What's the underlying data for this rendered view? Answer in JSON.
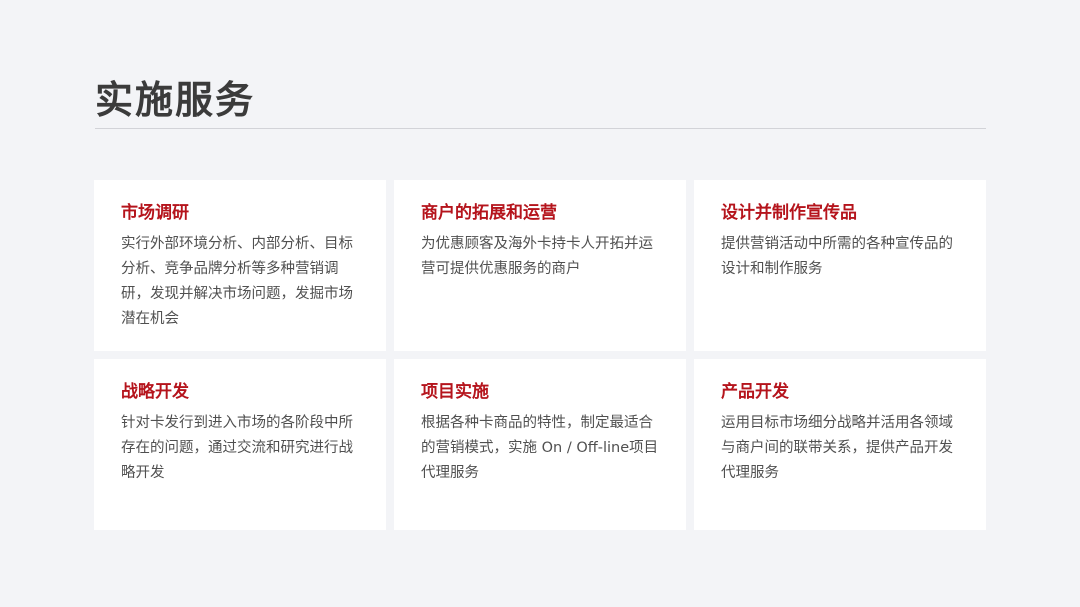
{
  "page": {
    "title": "实施服务"
  },
  "cards": [
    {
      "title": "市场调研",
      "description": "实行外部环境分析、内部分析、目标分析、竞争品牌分析等多种营销调研，发现并解决市场问题，发掘市场潜在机会"
    },
    {
      "title": "商户的拓展和运营",
      "description": "为优惠顾客及海外卡持卡人开拓并运营可提供优惠服务的商户"
    },
    {
      "title": "设计并制作宣传品",
      "description": "提供营销活动中所需的各种宣传品的设计和制作服务"
    },
    {
      "title": "战略开发",
      "description": "针对卡发行到进入市场的各阶段中所存在的问题，通过交流和研究进行战略开发"
    },
    {
      "title": "项目实施",
      "description": "根据各种卡商品的特性，制定最适合的营销模式，实施 On / Off-line项目代理服务"
    },
    {
      "title": "产品开发",
      "description": "运用目标市场细分战略并活用各领域与商户间的联带关系，提供产品开发代理服务"
    }
  ],
  "colors": {
    "background": "#f3f4f7",
    "card": "#ffffff",
    "accent": "#b5141c",
    "title_text": "#3b3b3b",
    "body_text": "#505050",
    "divider": "#d2d3d8"
  }
}
